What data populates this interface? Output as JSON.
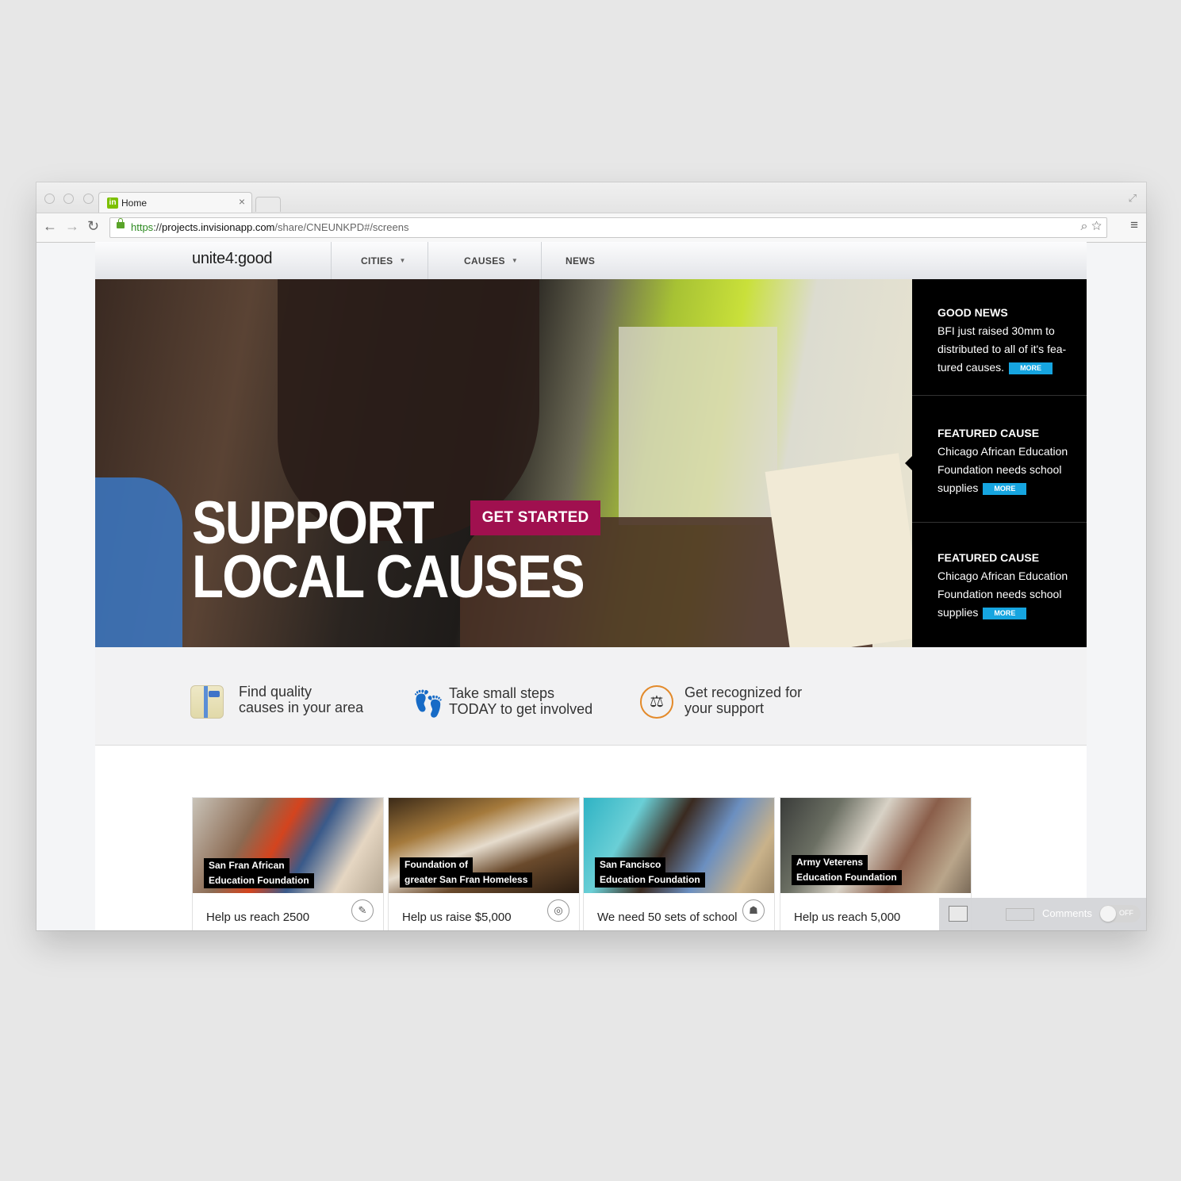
{
  "browser": {
    "tab_title": "Home",
    "tab_favicon": "in",
    "url_https": "https",
    "url_sep": "://",
    "url_domain": "projects.invisionapp.com",
    "url_path": "/share/CNEUNKPD#/screens"
  },
  "site": {
    "logo": "unite4:good",
    "nav": [
      {
        "label": "CITIES",
        "has_caret": true
      },
      {
        "label": "CAUSES",
        "has_caret": true
      },
      {
        "label": "NEWS",
        "has_caret": false
      }
    ]
  },
  "hero": {
    "title_line1": "SUPPORT",
    "title_line2": "LOCAL CAUSES",
    "cta": "GET STARTED",
    "cta_color": "#a0104f"
  },
  "news": [
    {
      "heading": "GOOD NEWS",
      "body": "BFI just raised 30mm to distributed to all of it's fea-tured causes.",
      "more": "MORE"
    },
    {
      "heading": "FEATURED CAUSE",
      "body": "Chicago African Education Foundation needs school supplies",
      "more": "MORE"
    },
    {
      "heading": "FEATURED CAUSE",
      "body": "Chicago African Education Foundation needs school supplies",
      "more": "MORE"
    }
  ],
  "features": [
    {
      "icon": "map-icon",
      "line1": "Find quality",
      "line2": "causes in your area"
    },
    {
      "icon": "footsteps-icon",
      "line1": "Take small steps",
      "line2": "TODAY to get involved"
    },
    {
      "icon": "scale-icon",
      "line1": "Get recognized for",
      "line2": "your support"
    }
  ],
  "cards": [
    {
      "label1": "San Fran African",
      "label2": "Education Foundation",
      "text": "Help us reach 2500",
      "icon": "pin-icon"
    },
    {
      "label1": "Foundation of",
      "label2": "greater San Fran Homeless",
      "text": "Help us raise $5,000",
      "icon": "camera-icon"
    },
    {
      "label1": "San Fancisco",
      "label2": "Education Foundation",
      "text": "We need 50 sets of school",
      "icon": "hat-icon"
    },
    {
      "label1": "Army Veterens",
      "label2": "Education Foundation",
      "text": "Help us reach 5,000",
      "icon": "pin-icon"
    }
  ],
  "comments_widget": {
    "label": "Comments",
    "toggle": "OFF"
  },
  "colors": {
    "accent_blue": "#16a5e0",
    "brand_magenta": "#a0104f"
  }
}
